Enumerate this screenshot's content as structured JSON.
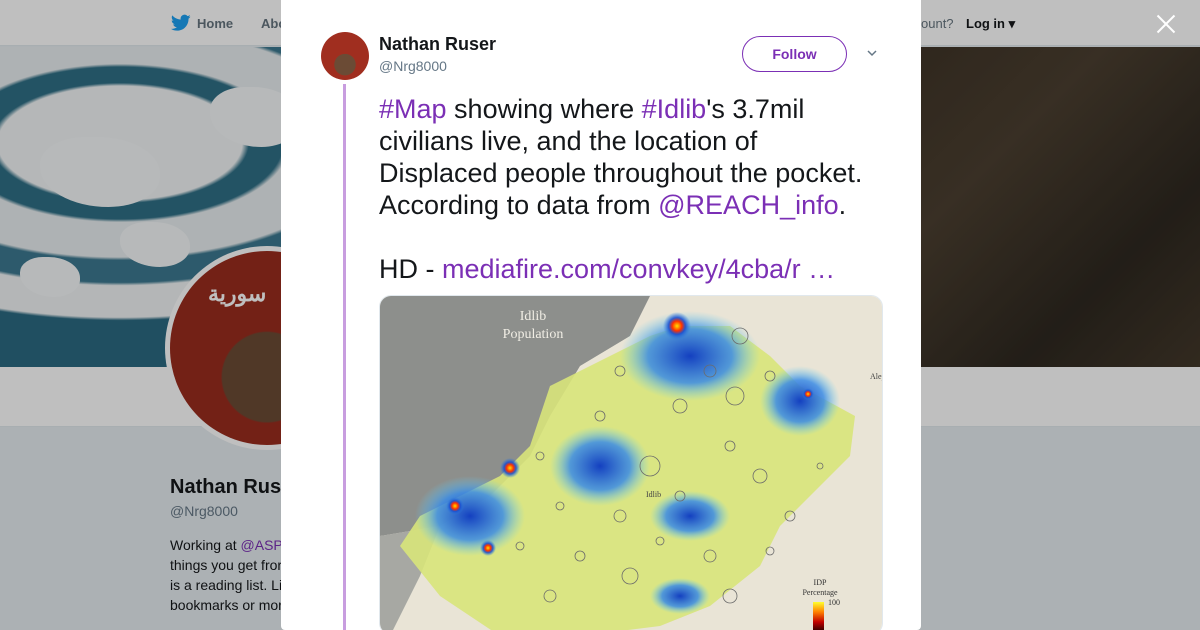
{
  "nav": {
    "home_label": "Home",
    "about_label": "Abo",
    "account_prompt": "ccount?",
    "login_label": "Log in"
  },
  "profile": {
    "name": "Nathan Rus",
    "handle": "@Nrg8000",
    "avatar_text": "سورية",
    "bio_lines": [
      "Working at @ASP",
      "things you get fror",
      "is a reading list. Li",
      "bookmarks or mor"
    ],
    "bio_mention": "@ASP",
    "bio_prefix": "Working at "
  },
  "modal": {
    "author_name": "Nathan Ruser",
    "author_handle": "@Nrg8000",
    "follow_label": "Follow",
    "tweet": {
      "tag_map": "#Map",
      "text_1": " showing where ",
      "tag_idlib": "#Idlib",
      "text_2": "'s 3.7mil",
      "line_2": "civilians live, and the location of",
      "line_3": "Displaced people throughout the pocket.",
      "text_4": "According to data from ",
      "mention_reach": "@REACH_info",
      "text_5": ".",
      "hd_prefix": "HD - ",
      "link": "mediafire.com/convkey/4cba/r …"
    },
    "media": {
      "map_title_1": "Idlib",
      "map_title_2": "Population",
      "legend_title_1": "IDP",
      "legend_title_2": "Percentage",
      "legend_max": "100",
      "label_idlib": "Idlib",
      "label_aleppo": "Alep"
    }
  },
  "colors": {
    "accent": "#7b2fb5",
    "thread_line": "#c89ddf",
    "twitter_blue": "#1da1f2"
  }
}
